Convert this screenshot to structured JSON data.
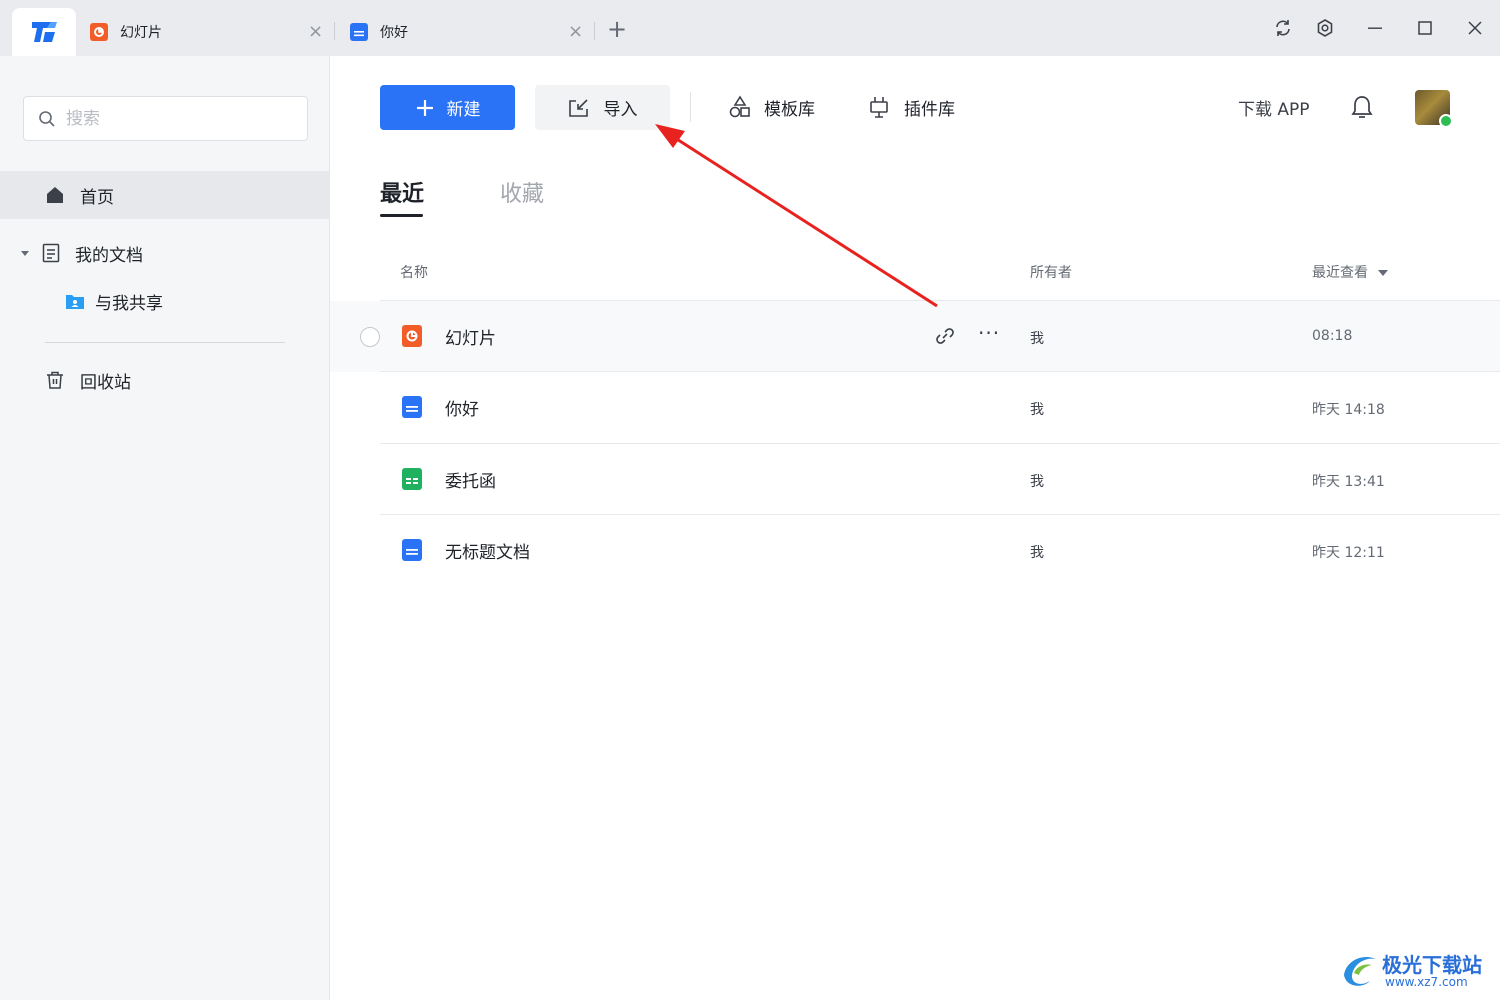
{
  "titlebar": {
    "tabs": [
      {
        "label": "幻灯片",
        "type": "ppt",
        "color": "#f25c29"
      },
      {
        "label": "你好",
        "type": "doc",
        "color": "#2a72f6"
      }
    ],
    "close_glyph": "×",
    "new_tab_glyph": "+"
  },
  "sidebar": {
    "search_placeholder": "搜索",
    "items": [
      {
        "label": "首页",
        "icon": "home-icon"
      },
      {
        "label": "我的文档",
        "icon": "document-icon"
      },
      {
        "label": "与我共享",
        "icon": "shared-folder-icon"
      },
      {
        "label": "回收站",
        "icon": "trash-icon"
      }
    ]
  },
  "toolbar": {
    "new_label": "新建",
    "import_label": "导入",
    "templates_label": "模板库",
    "plugins_label": "插件库",
    "download_app_label": "下载 APP"
  },
  "view_tabs": {
    "recent": "最近",
    "favorites": "收藏"
  },
  "table": {
    "columns": {
      "name": "名称",
      "owner": "所有者",
      "last_viewed": "最近查看"
    },
    "rows": [
      {
        "name": "幻灯片",
        "type": "ppt",
        "owner": "我",
        "time": "08:18"
      },
      {
        "name": "你好",
        "type": "doc",
        "owner": "我",
        "time": "昨天 14:18"
      },
      {
        "name": "委托函",
        "type": "sheet",
        "owner": "我",
        "time": "昨天 13:41"
      },
      {
        "name": "无标题文档",
        "type": "doc",
        "owner": "我",
        "time": "昨天 12:11"
      }
    ],
    "more_glyph": "···"
  },
  "colors": {
    "primary": "#2a72f6",
    "ppt": "#f25c29",
    "doc": "#2a72f6",
    "sheet": "#1fb160",
    "annotation_arrow": "#e8231f"
  },
  "watermark": {
    "name": "极光下载站",
    "url": "www.xz7.com"
  }
}
